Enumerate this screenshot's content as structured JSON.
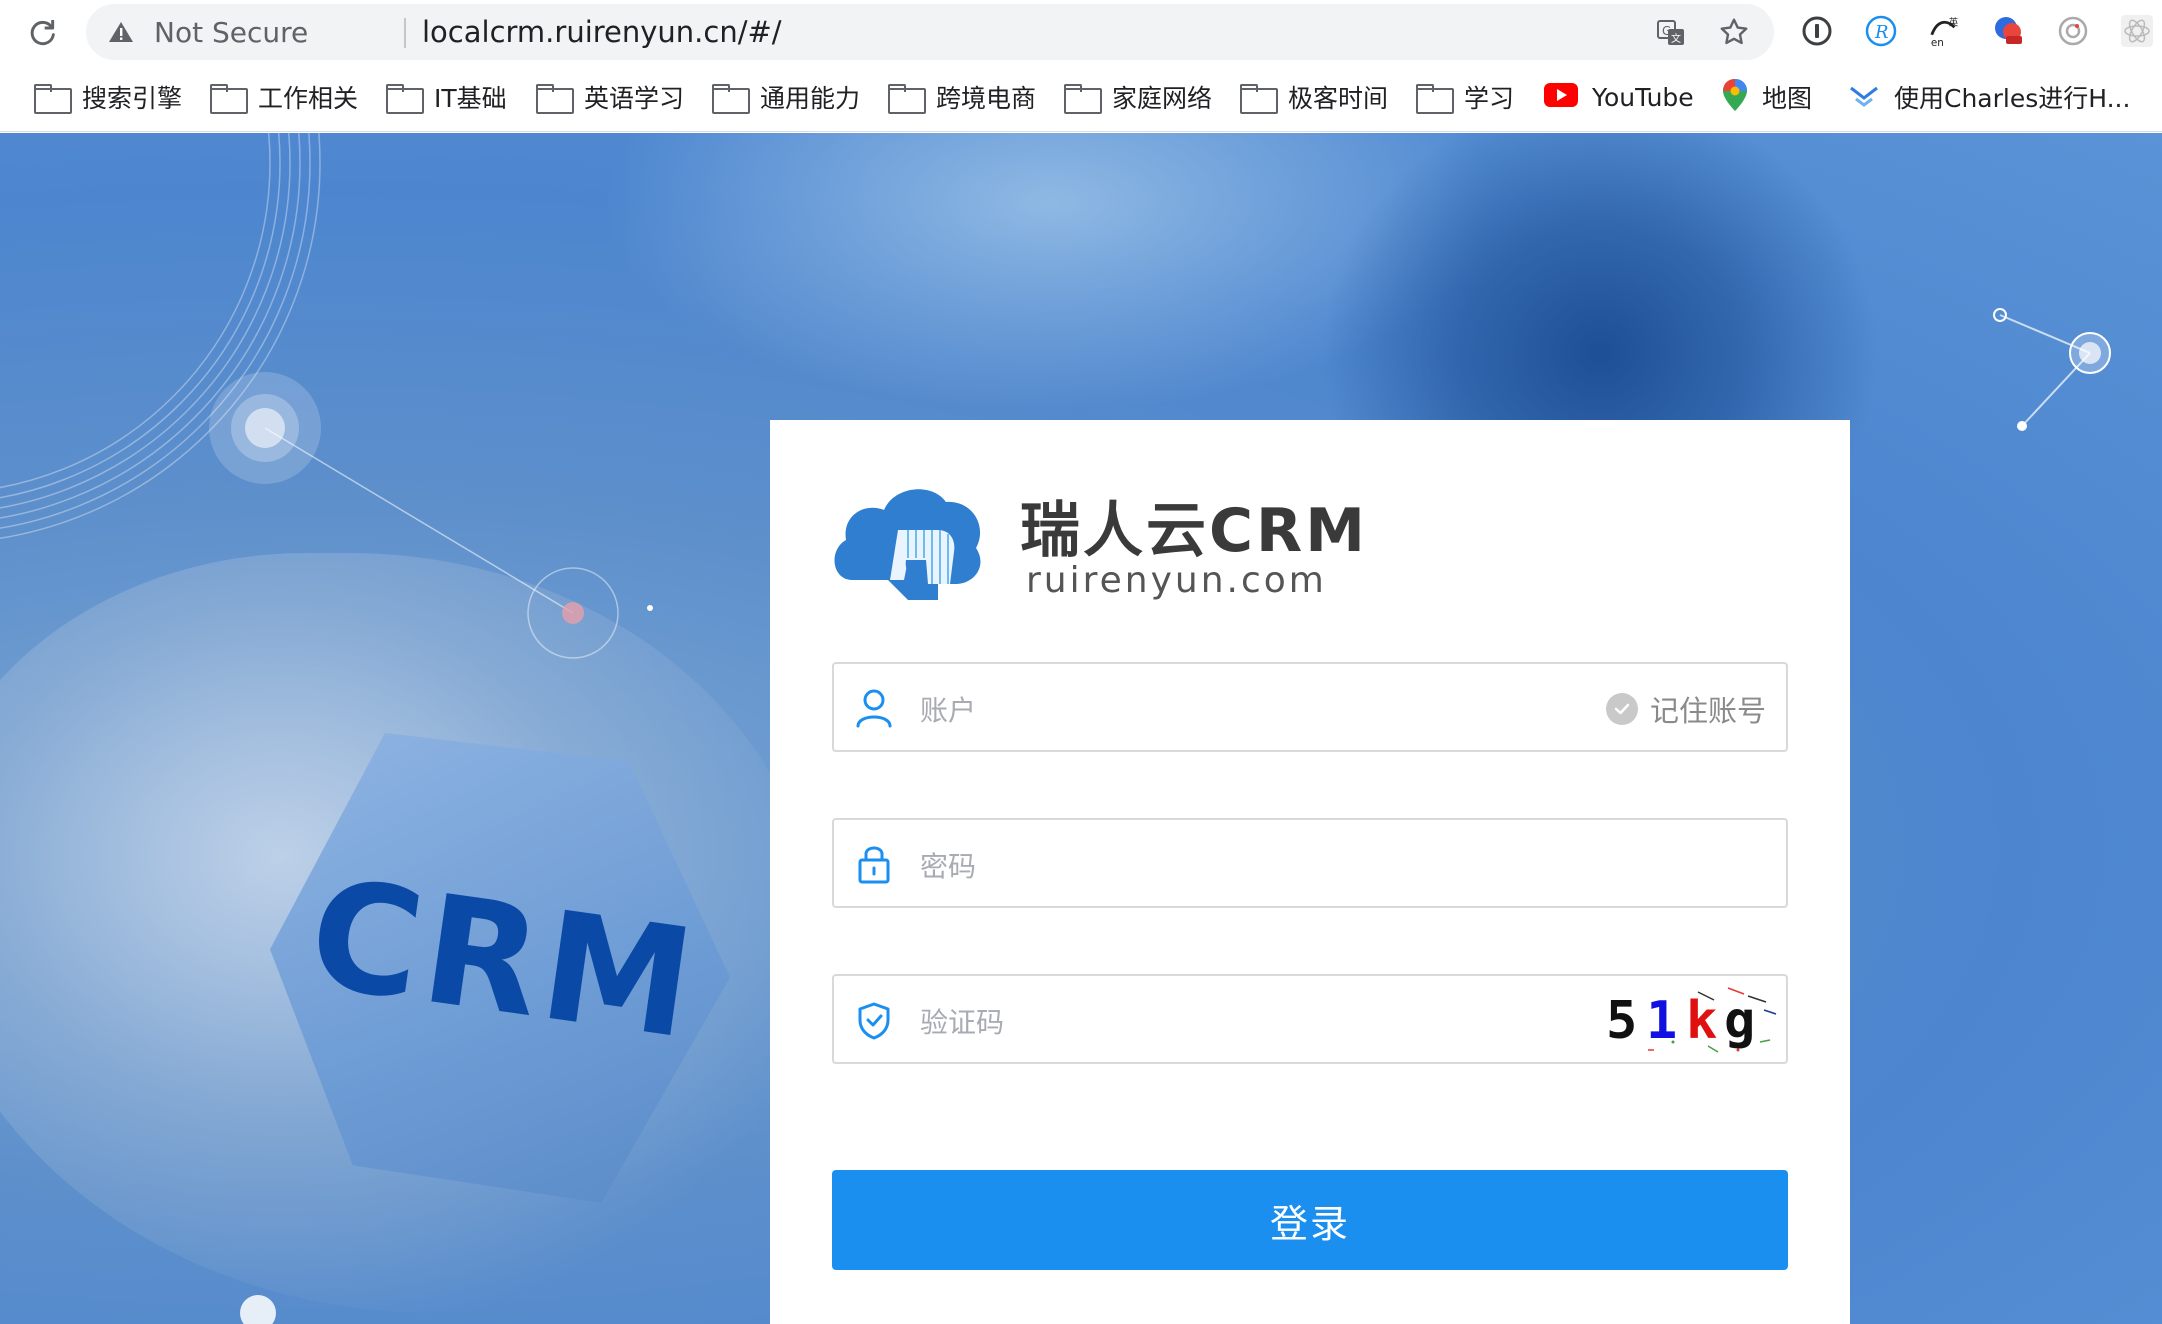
{
  "browser": {
    "security_label": "Not Secure",
    "url": "localcrm.ruirenyun.cn/#/",
    "bookmarks": [
      {
        "label": "搜索引擎",
        "icon": "folder-icon"
      },
      {
        "label": "工作相关",
        "icon": "folder-icon"
      },
      {
        "label": "IT基础",
        "icon": "folder-icon"
      },
      {
        "label": "英语学习",
        "icon": "folder-icon"
      },
      {
        "label": "通用能力",
        "icon": "folder-icon"
      },
      {
        "label": "跨境电商",
        "icon": "folder-icon"
      },
      {
        "label": "家庭网络",
        "icon": "folder-icon"
      },
      {
        "label": "极客时间",
        "icon": "folder-icon"
      },
      {
        "label": "学习",
        "icon": "folder-icon"
      },
      {
        "label": "YouTube",
        "icon": "youtube-icon"
      },
      {
        "label": "地图",
        "icon": "maps-pin-icon"
      },
      {
        "label": "使用Charles进行H...",
        "icon": "bookmark-site-icon"
      }
    ]
  },
  "background": {
    "hex_text": "CRM"
  },
  "login": {
    "brand_name": "瑞人云CRM",
    "brand_domain": "ruirenyun.com",
    "account_placeholder": "账户",
    "remember_label": "记住账号",
    "password_placeholder": "密码",
    "captcha_placeholder": "验证码",
    "captcha_chars": [
      "5",
      "1",
      "k",
      "g"
    ],
    "submit_label": "登录"
  },
  "colors": {
    "primary": "#1a8ff0",
    "icon_blue": "#1a8ff0",
    "card_bg": "#ffffff",
    "crm_text": "#0a4aa6"
  }
}
